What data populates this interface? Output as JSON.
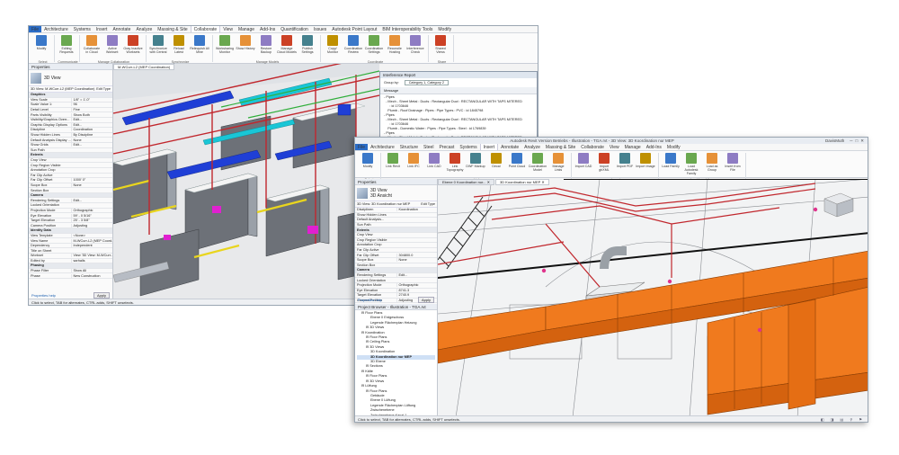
{
  "window_a": {
    "menu": [
      "File",
      "Architecture",
      "Systems",
      "Insert",
      "Annotate",
      "Analyze",
      "Massing & Site",
      "Collaborate",
      "View",
      "Manage",
      "Add-Ins",
      "Quantification",
      "Issues",
      "Autodesk Point Layout",
      "BIM Interoperability Tools",
      "Modify"
    ],
    "active_tab": "Collaborate",
    "ribbon_groups": [
      {
        "name": "Select",
        "buttons": [
          "Modify"
        ]
      },
      {
        "name": "Communicate",
        "buttons": [
          "Editing Requests"
        ]
      },
      {
        "name": "Manage Collaboration",
        "buttons": [
          "Collaborate in Cloud",
          "Active Workset:",
          "Gray Inactive Worksets"
        ]
      },
      {
        "name": "Synchronize",
        "buttons": [
          "Synchronize with Central",
          "Reload Latest",
          "Relinquish All Mine"
        ]
      },
      {
        "name": "Manage Models",
        "buttons": [
          "Worksharing Monitor",
          "Show History",
          "Restore Backup",
          "Manage Cloud Models",
          "Publish Settings"
        ]
      },
      {
        "name": "Coordinate",
        "buttons": [
          "Copy/ Monitor",
          "Coordination Review",
          "Coordination Settings",
          "Reconcile Hosting",
          "Interference Check"
        ]
      },
      {
        "name": "Share",
        "buttons": [
          "Shared Views"
        ]
      }
    ],
    "properties": {
      "title": "Properties",
      "type_name": "3D View",
      "selector": "3D View: M-WCurr-L2 (MEP Coordination)",
      "edit_type": "Edit Type",
      "rows": [
        {
          "k": "Graphics",
          "v": "",
          "cat": true
        },
        {
          "k": "View Scale",
          "v": "1/8\" = 1'-0\""
        },
        {
          "k": "Scale Value 1:",
          "v": "96"
        },
        {
          "k": "Detail Level",
          "v": "Fine"
        },
        {
          "k": "Parts Visibility",
          "v": "Show Both"
        },
        {
          "k": "Visibility/Graphics Overr...",
          "v": "Edit..."
        },
        {
          "k": "Graphic Display Options",
          "v": "Edit..."
        },
        {
          "k": "Discipline",
          "v": "Coordination"
        },
        {
          "k": "Show Hidden Lines",
          "v": "By Discipline"
        },
        {
          "k": "Default Analysis Display ...",
          "v": "None"
        },
        {
          "k": "Show Grids",
          "v": "Edit..."
        },
        {
          "k": "Sun Path",
          "v": ""
        },
        {
          "k": "Extents",
          "v": "",
          "cat": true
        },
        {
          "k": "Crop View",
          "v": ""
        },
        {
          "k": "Crop Region Visible",
          "v": ""
        },
        {
          "k": "Annotation Crop",
          "v": ""
        },
        {
          "k": "Far Clip Active",
          "v": ""
        },
        {
          "k": "Far Clip Offset",
          "v": "1000' 0\""
        },
        {
          "k": "Scope Box",
          "v": "None"
        },
        {
          "k": "Section Box",
          "v": ""
        },
        {
          "k": "Camera",
          "v": "",
          "cat": true
        },
        {
          "k": "Rendering Settings",
          "v": "Edit..."
        },
        {
          "k": "Locked Orientation",
          "v": ""
        },
        {
          "k": "Projection Mode",
          "v": "Orthographic"
        },
        {
          "k": "Eye Elevation",
          "v": "59' - 0 5/16\""
        },
        {
          "k": "Target Elevation",
          "v": "25' - 3 5/8\""
        },
        {
          "k": "Camera Position",
          "v": "Adjusting"
        },
        {
          "k": "Identity Data",
          "v": "",
          "cat": true
        },
        {
          "k": "View Template",
          "v": "<None>"
        },
        {
          "k": "View Name",
          "v": "M-WCurr-L2 (MEP Coord..."
        },
        {
          "k": "Dependency",
          "v": "Independent"
        },
        {
          "k": "Title on Sheet",
          "v": ""
        },
        {
          "k": "Workset",
          "v": "View '3D View: M-WCurr..."
        },
        {
          "k": "Edited by",
          "v": "sarhalls"
        },
        {
          "k": "Phasing",
          "v": "",
          "cat": true
        },
        {
          "k": "Phase Filter",
          "v": "Show All"
        },
        {
          "k": "Phase",
          "v": "New Construction"
        }
      ],
      "help_link": "Properties help",
      "apply": "Apply"
    },
    "view_tab": "M-WCurr-L2 (MEP Coordination)",
    "status": "Click to select, TAB for alternates, CTRL adds, SHIFT unselects.",
    "status_right": "Plumb - Sanitary and Vent (Not Ed",
    "dialog": {
      "title": "Interference Report",
      "group_by_label": "Group by:",
      "group_by_value": "Category 1, Category 2",
      "header": "Message",
      "rows": [
        "- Pipes",
        "  - Mech - Sheet Metal : Ducts : Rectangular Duct : RECTANGULAR WITH TAPS MITERED",
        "      : id 1703646",
        "    Plumb - Roof Drainage : Pipes : Pipe Types : PVC : id 1845798",
        "- Pipes",
        "  - Mech - Sheet Metal : Ducts : Rectangular Duct : RECTANGULAR WITH TAPS MITERED",
        "      : id 1703646",
        "    Plumb - Domestic Water : Pipes : Pipe Types : Steel : id 1769839",
        "- Pipes",
        "  - Mech - Sheet Metal : Ducts : Rectangular Duct : RECTANGULAR WITH TAPS MITERED",
        "      : id 1703646",
        "    Plumb - Sanitary : Pipes : Pipe Types : PVC : id 1780432",
        "- Pipes",
        "  - Mech - Sheet Metal : Ducts : Rectangular Duct : RECTANGULAR WITH TAPS MITERED"
      ]
    },
    "browser": {
      "title": "Project Browser - CV Housing - MEP Coordination_sthalls"
    }
  },
  "window_b": {
    "title": "Autodesk Revit Version Betriebs - Illustration - TGA.rvt - 3D View: 3D Koordination nur MEP",
    "user": "DavisMuth",
    "menu": [
      "File",
      "Architecture",
      "Structure",
      "Steel",
      "Precast",
      "Systems",
      "Insert",
      "Annotate",
      "Analyze",
      "Massing & Site",
      "Collaborate",
      "View",
      "Manage",
      "Add-Ins",
      "Modify"
    ],
    "active_tab": "Insert",
    "ribbon_groups": [
      {
        "name": "Select",
        "buttons": [
          "Modify"
        ]
      },
      {
        "name": "Link",
        "buttons": [
          "Link Revit",
          "Link IFC",
          "Link CAD",
          "Link Topography",
          "DWF Markup",
          "Decal",
          "Point Cloud",
          "Coordination Model",
          "Manage Links"
        ]
      },
      {
        "name": "Import",
        "buttons": [
          "Import CAD",
          "Import gbXML",
          "Import PDF",
          "Import Image"
        ]
      },
      {
        "name": "Load from Library",
        "buttons": [
          "Load Family",
          "Load Autodesk Family",
          "Load as Group",
          "Insert from File"
        ]
      }
    ],
    "properties": {
      "title": "Properties",
      "type_name": "3D View",
      "type_sub": "3D Ansicht",
      "selector": "3D View: 3D Koordination nur MEP",
      "edit_type": "Edit Type",
      "rows": [
        {
          "k": "Disziplinen",
          "v": "Koordination"
        },
        {
          "k": "Show Hidden Lines",
          "v": ""
        },
        {
          "k": "Default Analysis...",
          "v": ""
        },
        {
          "k": "Sun Path",
          "v": ""
        },
        {
          "k": "Extents",
          "v": "",
          "cat": true
        },
        {
          "k": "Crop View",
          "v": ""
        },
        {
          "k": "Crop Region Visible",
          "v": ""
        },
        {
          "k": "Annotation Crop",
          "v": ""
        },
        {
          "k": "Far Clip Active",
          "v": ""
        },
        {
          "k": "Far Clip Offset",
          "v": "304800.0"
        },
        {
          "k": "Scope Box",
          "v": "None"
        },
        {
          "k": "Section Box",
          "v": ""
        },
        {
          "k": "Camera",
          "v": "",
          "cat": true
        },
        {
          "k": "Rendering Settings",
          "v": "Edit..."
        },
        {
          "k": "Locked Orientation",
          "v": ""
        },
        {
          "k": "Projection Mode",
          "v": "Orthographic"
        },
        {
          "k": "Eye Elevation",
          "v": "8741.3"
        },
        {
          "k": "Target Elevation",
          "v": "2740.9"
        },
        {
          "k": "Camera Position",
          "v": "Adjusting"
        }
      ],
      "help_link": "Properties help",
      "apply": "Apply"
    },
    "view_tabs": [
      "Ebene 0 Koordination nur...",
      "3D Koordination nur MEP"
    ],
    "browser": {
      "title": "Project Browser - Illustration - TGA.rvt",
      "items": [
        {
          "t": "Floor Plans",
          "d": 1
        },
        {
          "t": "Ebene 0 Erdgeschoss",
          "d": 3
        },
        {
          "t": "Legende Flächenplan Heizung",
          "d": 3
        },
        {
          "t": "3D Views",
          "d": 2
        },
        {
          "t": "Koordination",
          "d": 1
        },
        {
          "t": "Floor Plans",
          "d": 2
        },
        {
          "t": "Ceiling Plans",
          "d": 2
        },
        {
          "t": "3D Views",
          "d": 2
        },
        {
          "t": "3D Koordination",
          "d": 3
        },
        {
          "t": "3D Koordination nur MEP",
          "d": 3,
          "sel": true
        },
        {
          "t": "3D Ebene",
          "d": 3
        },
        {
          "t": "Sections",
          "d": 2
        },
        {
          "t": "Kälte",
          "d": 1
        },
        {
          "t": "Floor Plans",
          "d": 2
        },
        {
          "t": "3D Views",
          "d": 2
        },
        {
          "t": "Lüftung",
          "d": 1
        },
        {
          "t": "Floor Plans",
          "d": 2
        },
        {
          "t": "Gebäude",
          "d": 3
        },
        {
          "t": "Ebene 0 Lüftung",
          "d": 3
        },
        {
          "t": "Legende Flächenplan Lüftung",
          "d": 3
        },
        {
          "t": "Zwischenebene",
          "d": 3
        },
        {
          "t": "Zwischenebene Kanal 1",
          "d": 3
        }
      ]
    },
    "status": "Click to select, TAB for alternates, CTRL adds, SHIFT unselects.",
    "colors": {
      "duct": "#f07a1e",
      "pipe_red": "#c1272d",
      "pipe_pink": "#e0338c"
    }
  }
}
